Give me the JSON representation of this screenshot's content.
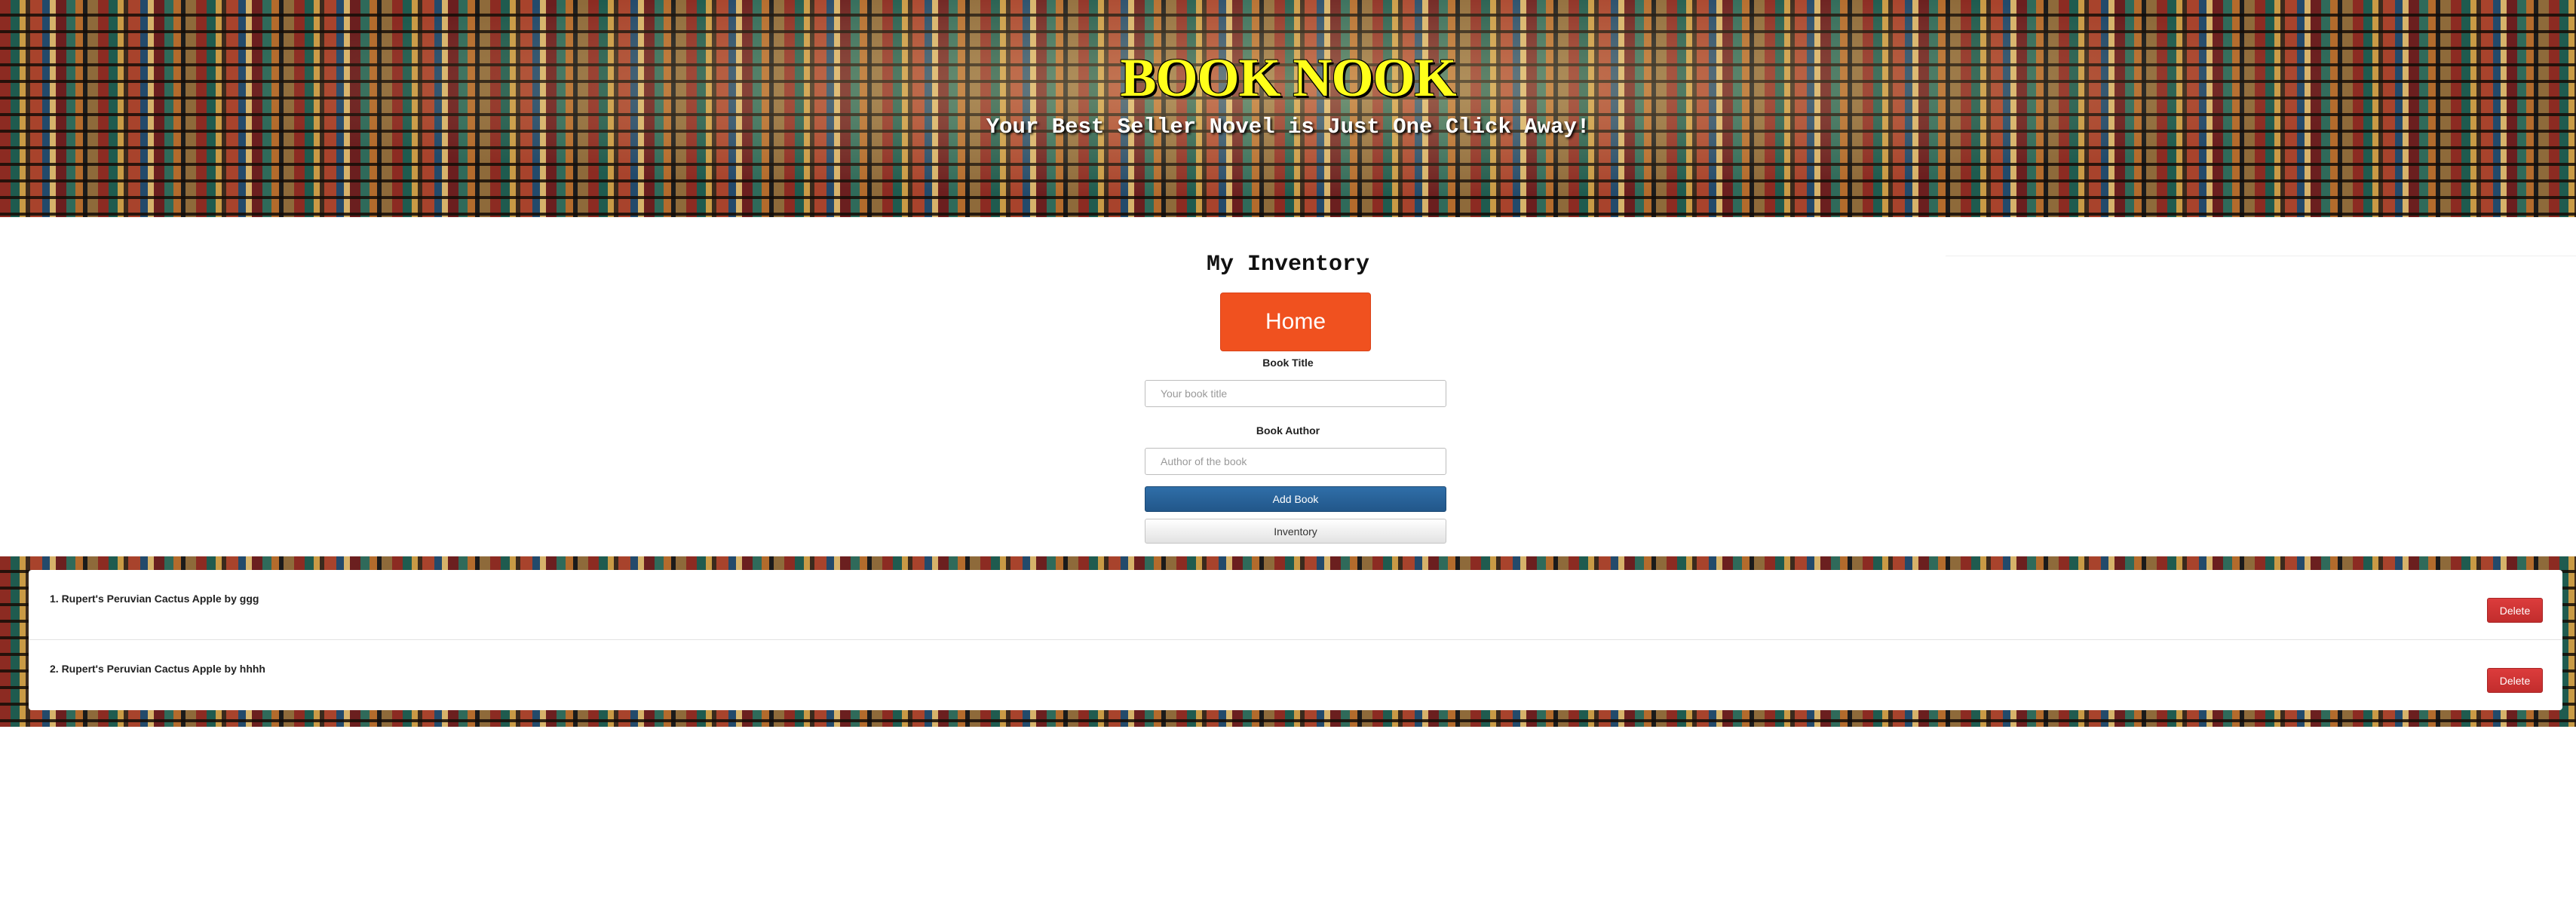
{
  "header": {
    "brand": "BOOK NOOK",
    "tagline": "Your Best Seller Novel is Just One Click Away!"
  },
  "main": {
    "title": "My Inventory",
    "home_label": "Home",
    "title_field": {
      "label": "Book Title",
      "placeholder": "Your book title",
      "value": ""
    },
    "author_field": {
      "label": "Book Author",
      "placeholder": "Author of the book",
      "value": ""
    },
    "add_label": "Add Book",
    "inventory_label": "Inventory"
  },
  "inventory": {
    "items": [
      {
        "text": "1. Rupert's Peruvian Cactus Apple by ggg",
        "delete_label": "Delete"
      },
      {
        "text": "2. Rupert's Peruvian Cactus Apple by hhhh",
        "delete_label": "Delete"
      }
    ]
  },
  "colors": {
    "brand": "#ffff1a",
    "home_button": "#f0511f",
    "add_button": "#22578a",
    "delete_button": "#c22d2d"
  }
}
